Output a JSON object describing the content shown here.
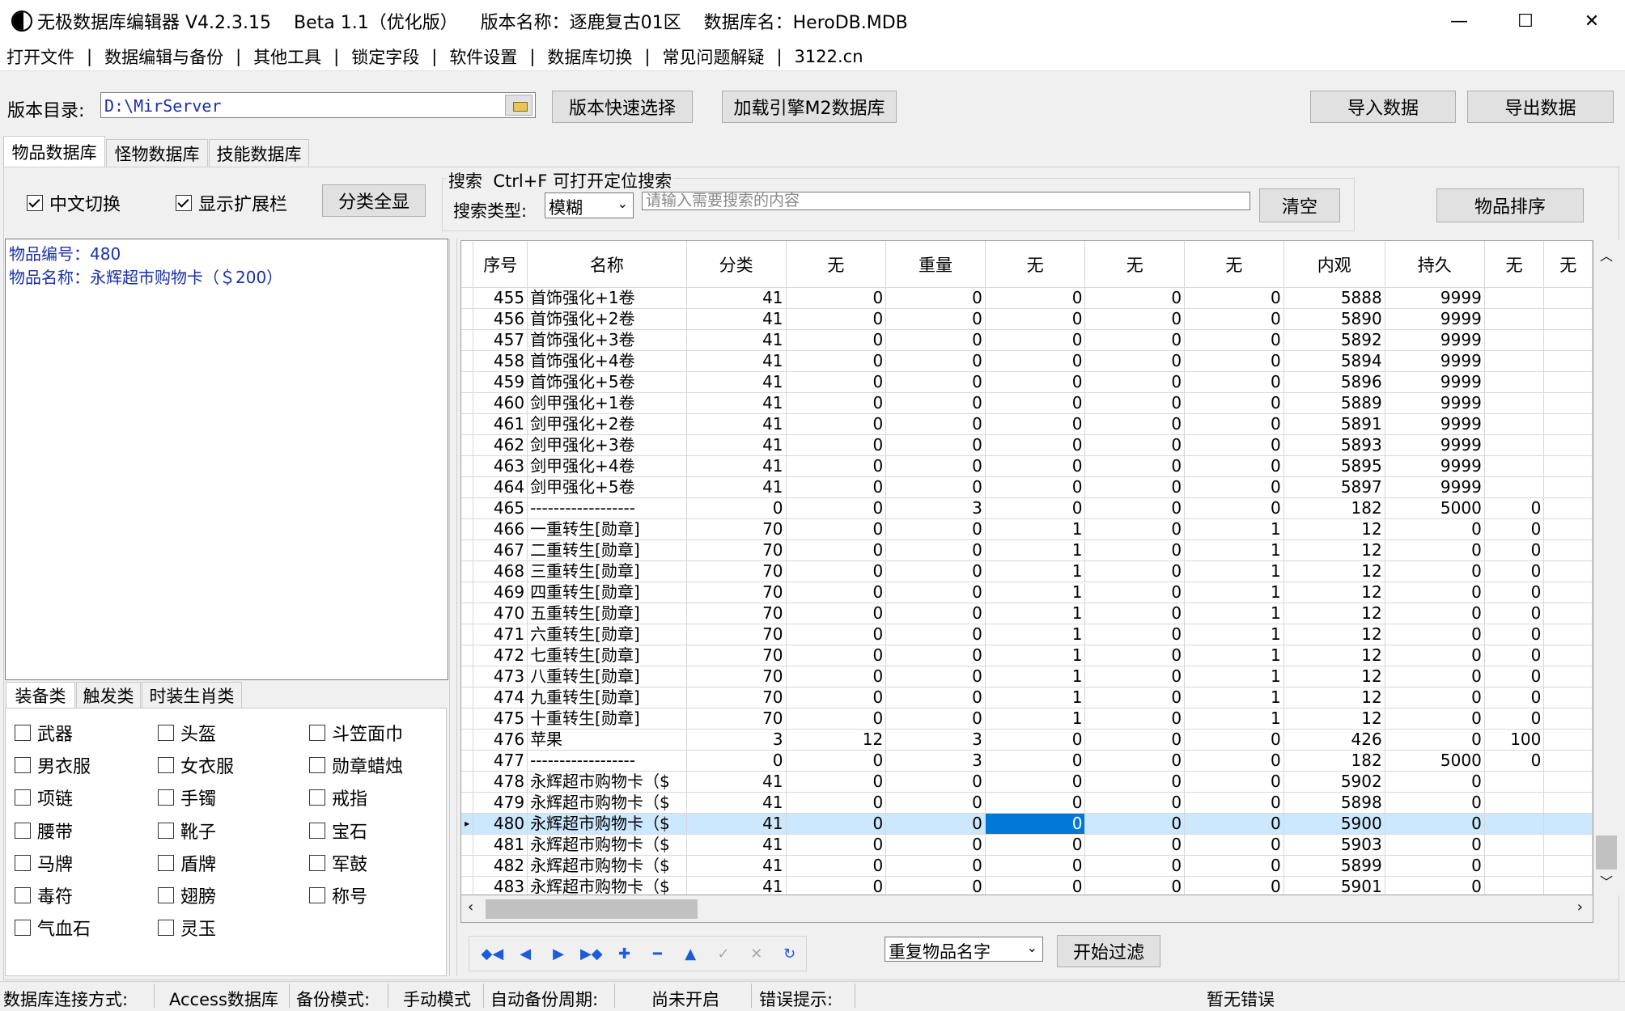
{
  "window": {
    "title": "无极数据库编辑器 V4.2.3.15    Beta 1.1（优化版）    版本名称：逐鹿复古01区    数据库名：HeroDB.MDB",
    "minimize": "—",
    "maximize": "☐",
    "close": "✕"
  },
  "menu": [
    "打开文件",
    "数据编辑与备份",
    "其他工具",
    "锁定字段",
    "软件设置",
    "数据库切换",
    "常见问题解疑",
    "3122.cn"
  ],
  "menu_sep": "|",
  "toolbar": {
    "path_label": "版本目录:",
    "path_value": "D:\\MirServer",
    "quick_select": "版本快速选择",
    "load_m2": "加载引擎M2数据库",
    "import": "导入数据",
    "export": "导出数据"
  },
  "tabs": [
    "物品数据库",
    "怪物数据库",
    "技能数据库"
  ],
  "options": {
    "chinese_switch": "中文切换",
    "show_ext": "显示扩展栏",
    "show_all": "分类全显"
  },
  "search": {
    "title": "搜索  Ctrl+F 可打开定位搜索",
    "type_label": "搜索类型:",
    "type_value": "模糊",
    "placeholder": "请输入需要搜索的内容",
    "clear": "清空"
  },
  "sort_button": "物品排序",
  "info": {
    "line1": "物品编号：480",
    "line2": "物品名称：永辉超市购物卡（＄200）"
  },
  "subtabs": [
    "装备类",
    "触发类",
    "时装生肖类"
  ],
  "categories": [
    [
      "武器",
      "头盔",
      "斗笠面巾"
    ],
    [
      "男衣服",
      "女衣服",
      "勋章蜡烛"
    ],
    [
      "项链",
      "手镯",
      "戒指"
    ],
    [
      "腰带",
      "靴子",
      "宝石"
    ],
    [
      "马牌",
      "盾牌",
      "军鼓"
    ],
    [
      "毒符",
      "翅膀",
      "称号"
    ],
    [
      "气血石",
      "灵玉",
      ""
    ]
  ],
  "grid": {
    "columns": [
      "序号",
      "名称",
      "分类",
      "无",
      "重量",
      "无",
      "无",
      "无",
      "内观",
      "持久",
      "无",
      "无"
    ],
    "selected_index": 25,
    "rows": [
      [
        "455",
        "首饰强化+1卷",
        "41",
        "0",
        "0",
        "0",
        "0",
        "0",
        "5888",
        "9999",
        "",
        ""
      ],
      [
        "456",
        "首饰强化+2卷",
        "41",
        "0",
        "0",
        "0",
        "0",
        "0",
        "5890",
        "9999",
        "",
        ""
      ],
      [
        "457",
        "首饰强化+3卷",
        "41",
        "0",
        "0",
        "0",
        "0",
        "0",
        "5892",
        "9999",
        "",
        ""
      ],
      [
        "458",
        "首饰强化+4卷",
        "41",
        "0",
        "0",
        "0",
        "0",
        "0",
        "5894",
        "9999",
        "",
        ""
      ],
      [
        "459",
        "首饰强化+5卷",
        "41",
        "0",
        "0",
        "0",
        "0",
        "0",
        "5896",
        "9999",
        "",
        ""
      ],
      [
        "460",
        "剑甲强化+1卷",
        "41",
        "0",
        "0",
        "0",
        "0",
        "0",
        "5889",
        "9999",
        "",
        ""
      ],
      [
        "461",
        "剑甲强化+2卷",
        "41",
        "0",
        "0",
        "0",
        "0",
        "0",
        "5891",
        "9999",
        "",
        ""
      ],
      [
        "462",
        "剑甲强化+3卷",
        "41",
        "0",
        "0",
        "0",
        "0",
        "0",
        "5893",
        "9999",
        "",
        ""
      ],
      [
        "463",
        "剑甲强化+4卷",
        "41",
        "0",
        "0",
        "0",
        "0",
        "0",
        "5895",
        "9999",
        "",
        ""
      ],
      [
        "464",
        "剑甲强化+5卷",
        "41",
        "0",
        "0",
        "0",
        "0",
        "0",
        "5897",
        "9999",
        "",
        ""
      ],
      [
        "465",
        "------------------",
        "0",
        "0",
        "3",
        "0",
        "0",
        "0",
        "182",
        "5000",
        "0",
        ""
      ],
      [
        "466",
        "一重转生[勋章]",
        "70",
        "0",
        "0",
        "1",
        "0",
        "1",
        "12",
        "0",
        "0",
        ""
      ],
      [
        "467",
        "二重转生[勋章]",
        "70",
        "0",
        "0",
        "1",
        "0",
        "1",
        "12",
        "0",
        "0",
        ""
      ],
      [
        "468",
        "三重转生[勋章]",
        "70",
        "0",
        "0",
        "1",
        "0",
        "1",
        "12",
        "0",
        "0",
        ""
      ],
      [
        "469",
        "四重转生[勋章]",
        "70",
        "0",
        "0",
        "1",
        "0",
        "1",
        "12",
        "0",
        "0",
        ""
      ],
      [
        "470",
        "五重转生[勋章]",
        "70",
        "0",
        "0",
        "1",
        "0",
        "1",
        "12",
        "0",
        "0",
        ""
      ],
      [
        "471",
        "六重转生[勋章]",
        "70",
        "0",
        "0",
        "1",
        "0",
        "1",
        "12",
        "0",
        "0",
        ""
      ],
      [
        "472",
        "七重转生[勋章]",
        "70",
        "0",
        "0",
        "1",
        "0",
        "1",
        "12",
        "0",
        "0",
        ""
      ],
      [
        "473",
        "八重转生[勋章]",
        "70",
        "0",
        "0",
        "1",
        "0",
        "1",
        "12",
        "0",
        "0",
        ""
      ],
      [
        "474",
        "九重转生[勋章]",
        "70",
        "0",
        "0",
        "1",
        "0",
        "1",
        "12",
        "0",
        "0",
        ""
      ],
      [
        "475",
        "十重转生[勋章]",
        "70",
        "0",
        "0",
        "1",
        "0",
        "1",
        "12",
        "0",
        "0",
        ""
      ],
      [
        "476",
        "苹果",
        "3",
        "12",
        "3",
        "0",
        "0",
        "0",
        "426",
        "0",
        "100",
        ""
      ],
      [
        "477",
        "------------------",
        "0",
        "0",
        "3",
        "0",
        "0",
        "0",
        "182",
        "5000",
        "0",
        ""
      ],
      [
        "478",
        "永辉超市购物卡（$",
        "41",
        "0",
        "0",
        "0",
        "0",
        "0",
        "5902",
        "0",
        "",
        ""
      ],
      [
        "479",
        "永辉超市购物卡（$",
        "41",
        "0",
        "0",
        "0",
        "0",
        "0",
        "5898",
        "0",
        "",
        ""
      ],
      [
        "480",
        "永辉超市购物卡（$",
        "41",
        "0",
        "0",
        "0",
        "0",
        "0",
        "5900",
        "0",
        "",
        ""
      ],
      [
        "481",
        "永辉超市购物卡（$",
        "41",
        "0",
        "0",
        "0",
        "0",
        "0",
        "5903",
        "0",
        "",
        ""
      ],
      [
        "482",
        "永辉超市购物卡（$",
        "41",
        "0",
        "0",
        "0",
        "0",
        "0",
        "5899",
        "0",
        "",
        ""
      ],
      [
        "483",
        "永辉超市购物卡（$",
        "41",
        "0",
        "0",
        "0",
        "0",
        "0",
        "5901",
        "0",
        "",
        ""
      ]
    ]
  },
  "navigator": {
    "buttons": [
      "first-icon",
      "prior-icon",
      "next-icon",
      "last-icon",
      "insert-icon",
      "delete-icon",
      "edit-icon",
      "post-icon",
      "cancel-icon",
      "refresh-icon"
    ]
  },
  "filter": {
    "select_value": "重复物品名字",
    "start": "开始过滤"
  },
  "status": {
    "conn_label": "数据库连接方式:",
    "conn_value": "Access数据库",
    "backup_label": "备份模式:",
    "backup_value": "手动模式",
    "auto_label": "自动备份周期:",
    "auto_value": "尚未开启",
    "err_label": "错误提示:",
    "err_value": "暂无错误"
  },
  "colors": {
    "selected_row": "#cce8ff",
    "current_cell": "#0078d7",
    "info_text": "#1a2fa8",
    "nav_icons": "#1e5bd8"
  }
}
